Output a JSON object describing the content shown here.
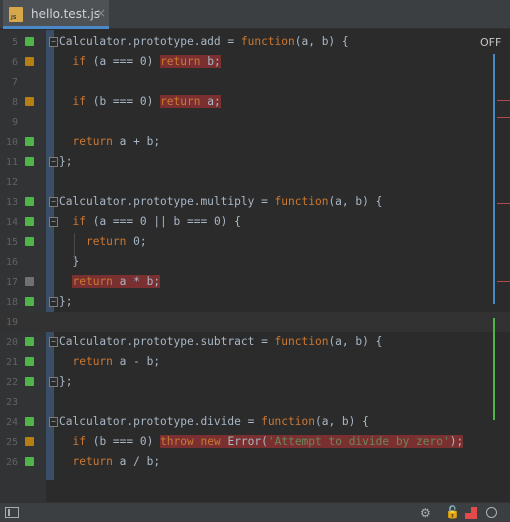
{
  "tab": {
    "icon": "js-file-icon",
    "icon_text": "JS",
    "label": "hello.test.js",
    "close": "×"
  },
  "badge": "OFF",
  "colors": {
    "covered": "#4fb549",
    "partial": "#b77f12",
    "uncovered": "#6f7275",
    "highlight": "#7a3030",
    "keyword": "#cc7832",
    "string": "#6a8759"
  },
  "lines": [
    {
      "n": "5",
      "cov": "g",
      "fold": "⊟",
      "segs": [
        [
          "t",
          "Calculator.prototype.add = "
        ],
        [
          "k",
          "function"
        ],
        [
          "t",
          "(a, b) {"
        ]
      ]
    },
    {
      "n": "6",
      "cov": "o",
      "fold": "",
      "segs": [
        [
          "t",
          "  "
        ],
        [
          "k",
          "if"
        ],
        [
          "t",
          " (a === 0) "
        ],
        [
          "h",
          [
            [
              "k",
              "return"
            ],
            [
              "t",
              " b;"
            ]
          ]
        ]
      ]
    },
    {
      "n": "7",
      "cov": "",
      "fold": "",
      "segs": []
    },
    {
      "n": "8",
      "cov": "o",
      "fold": "",
      "segs": [
        [
          "t",
          "  "
        ],
        [
          "k",
          "if"
        ],
        [
          "t",
          " (b === 0) "
        ],
        [
          "h",
          [
            [
              "k",
              "return"
            ],
            [
              "t",
              " a;"
            ]
          ]
        ]
      ]
    },
    {
      "n": "9",
      "cov": "",
      "fold": "",
      "segs": []
    },
    {
      "n": "10",
      "cov": "g",
      "fold": "",
      "segs": [
        [
          "t",
          "  "
        ],
        [
          "k",
          "return"
        ],
        [
          "t",
          " a + b;"
        ]
      ]
    },
    {
      "n": "11",
      "cov": "g",
      "fold": "⊟",
      "segs": [
        [
          "t",
          "};"
        ]
      ]
    },
    {
      "n": "12",
      "cov": "",
      "fold": "",
      "segs": []
    },
    {
      "n": "13",
      "cov": "g",
      "fold": "⊟",
      "segs": [
        [
          "t",
          "Calculator.prototype.multiply = "
        ],
        [
          "k",
          "function"
        ],
        [
          "t",
          "(a, b) {"
        ]
      ]
    },
    {
      "n": "14",
      "cov": "g",
      "fold": "⊟",
      "segs": [
        [
          "t",
          "  "
        ],
        [
          "k",
          "if"
        ],
        [
          "t",
          " (a === 0 || b === 0) {"
        ]
      ]
    },
    {
      "n": "15",
      "cov": "g",
      "fold": "",
      "segs": [
        [
          "t",
          "    "
        ],
        [
          "k",
          "return"
        ],
        [
          "t",
          " 0;"
        ]
      ]
    },
    {
      "n": "16",
      "cov": "",
      "fold": "",
      "segs": [
        [
          "t",
          "  }"
        ]
      ]
    },
    {
      "n": "17",
      "cov": "x",
      "fold": "",
      "segs": [
        [
          "t",
          "  "
        ],
        [
          "h",
          [
            [
              "k",
              "return"
            ],
            [
              "t",
              " a * b;"
            ]
          ]
        ]
      ]
    },
    {
      "n": "18",
      "cov": "g",
      "fold": "⊟",
      "segs": [
        [
          "t",
          "};"
        ]
      ]
    },
    {
      "n": "19",
      "cov": "",
      "fold": "",
      "segs": [],
      "current": true
    },
    {
      "n": "20",
      "cov": "g",
      "fold": "⊟",
      "segs": [
        [
          "t",
          "Calculator.prototype.subtract = "
        ],
        [
          "k",
          "function"
        ],
        [
          "t",
          "(a, b) {"
        ]
      ]
    },
    {
      "n": "21",
      "cov": "g",
      "fold": "",
      "segs": [
        [
          "t",
          "  "
        ],
        [
          "k",
          "return"
        ],
        [
          "t",
          " a - b;"
        ]
      ]
    },
    {
      "n": "22",
      "cov": "g",
      "fold": "⊟",
      "segs": [
        [
          "t",
          "};"
        ]
      ]
    },
    {
      "n": "23",
      "cov": "",
      "fold": "",
      "segs": []
    },
    {
      "n": "24",
      "cov": "g",
      "fold": "⊟",
      "segs": [
        [
          "t",
          "Calculator.prototype.divide = "
        ],
        [
          "k",
          "function"
        ],
        [
          "t",
          "(a, b) {"
        ]
      ]
    },
    {
      "n": "25",
      "cov": "o",
      "fold": "",
      "segs": [
        [
          "t",
          "  "
        ],
        [
          "k",
          "if"
        ],
        [
          "t",
          " (b === 0) "
        ],
        [
          "h",
          [
            [
              "k",
              "throw"
            ],
            [
              "t",
              " "
            ],
            [
              "k",
              "new"
            ],
            [
              "t",
              " Error("
            ],
            [
              "s",
              "'Attempt to divide by zero'"
            ],
            [
              "t",
              ");"
            ]
          ]
        ]
      ]
    },
    {
      "n": "26",
      "cov": "g",
      "fold": "",
      "segs": [
        [
          "t",
          "  "
        ],
        [
          "k",
          "return"
        ],
        [
          "t",
          " a / b;"
        ]
      ]
    }
  ],
  "statusbar": {
    "left_icon": "panel-toggle-icon",
    "gear_icon": "⚙",
    "lock_icon": "🔓",
    "hector_icon": "hector-icon",
    "bubble_icon": "notifications-icon"
  }
}
